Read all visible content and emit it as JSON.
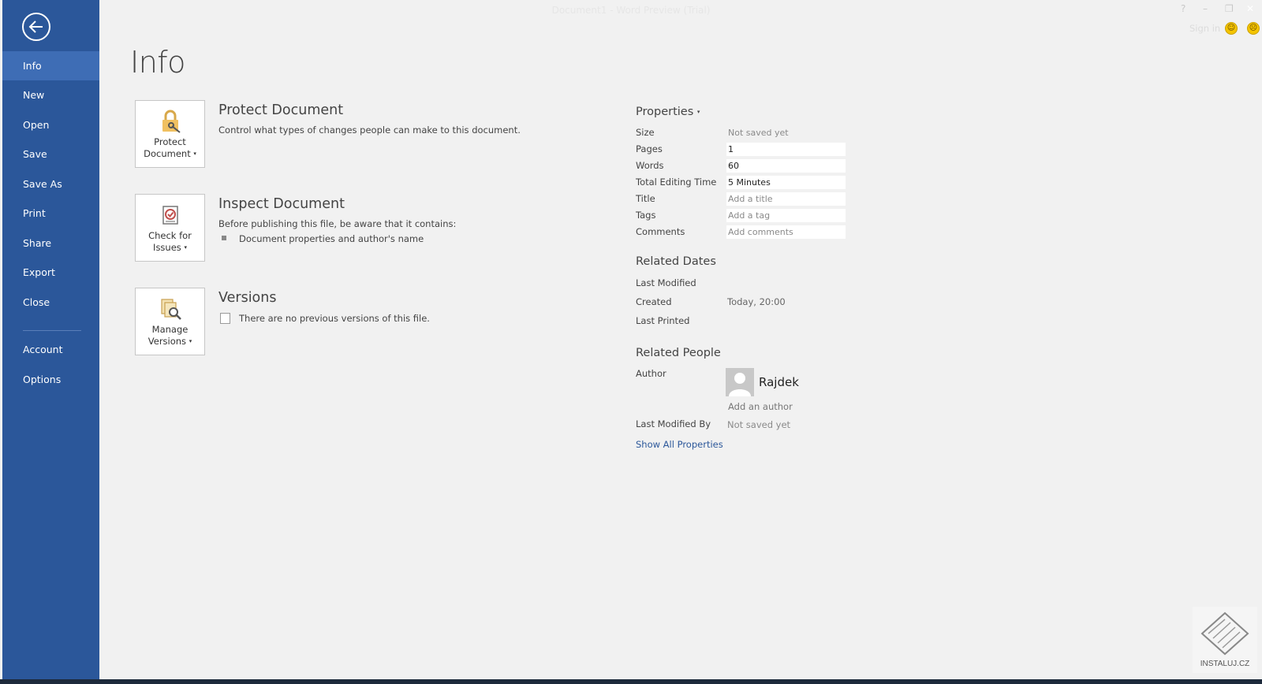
{
  "window": {
    "title": "Document1 - Word Preview (Trial)",
    "sign_in": "Sign in",
    "help": "?",
    "minimize": "–",
    "restore": "❐",
    "close": "✕"
  },
  "sidebar": {
    "items": [
      {
        "label": "Info"
      },
      {
        "label": "New"
      },
      {
        "label": "Open"
      },
      {
        "label": "Save"
      },
      {
        "label": "Save As"
      },
      {
        "label": "Print"
      },
      {
        "label": "Share"
      },
      {
        "label": "Export"
      },
      {
        "label": "Close"
      },
      {
        "label": "Account"
      },
      {
        "label": "Options"
      }
    ]
  },
  "page": {
    "title": "Info"
  },
  "sections": {
    "protect": {
      "button_line1": "Protect",
      "button_line2": "Document",
      "heading": "Protect Document",
      "desc": "Control what types of changes people can make to this document."
    },
    "inspect": {
      "button_line1": "Check for",
      "button_line2": "Issues",
      "heading": "Inspect Document",
      "desc": "Before publishing this file, be aware that it contains:",
      "bullet": "Document properties and author's name"
    },
    "versions": {
      "button_line1": "Manage",
      "button_line2": "Versions",
      "heading": "Versions",
      "desc": "There are no previous versions of this file."
    }
  },
  "properties": {
    "heading": "Properties",
    "size": {
      "label": "Size",
      "value": "Not saved yet"
    },
    "pages": {
      "label": "Pages",
      "value": "1"
    },
    "words": {
      "label": "Words",
      "value": "60"
    },
    "editing_time": {
      "label": "Total Editing Time",
      "value": "5 Minutes"
    },
    "title": {
      "label": "Title",
      "value": "Add a title"
    },
    "tags": {
      "label": "Tags",
      "value": "Add a tag"
    },
    "comments": {
      "label": "Comments",
      "value": "Add comments"
    }
  },
  "related_dates": {
    "heading": "Related Dates",
    "last_modified": {
      "label": "Last Modified",
      "value": ""
    },
    "created": {
      "label": "Created",
      "value": "Today, 20:00"
    },
    "last_printed": {
      "label": "Last Printed",
      "value": ""
    }
  },
  "related_people": {
    "heading": "Related People",
    "author_label": "Author",
    "author_name": "Rajdek",
    "add_author": "Add an author",
    "last_modified_by": {
      "label": "Last Modified By",
      "value": "Not saved yet"
    }
  },
  "show_all": "Show All Properties",
  "watermark": "INSTALUJ.CZ",
  "colors": {
    "accent": "#2b579a",
    "sidebar_active": "#3e6db5",
    "background": "#f1f1f1"
  }
}
